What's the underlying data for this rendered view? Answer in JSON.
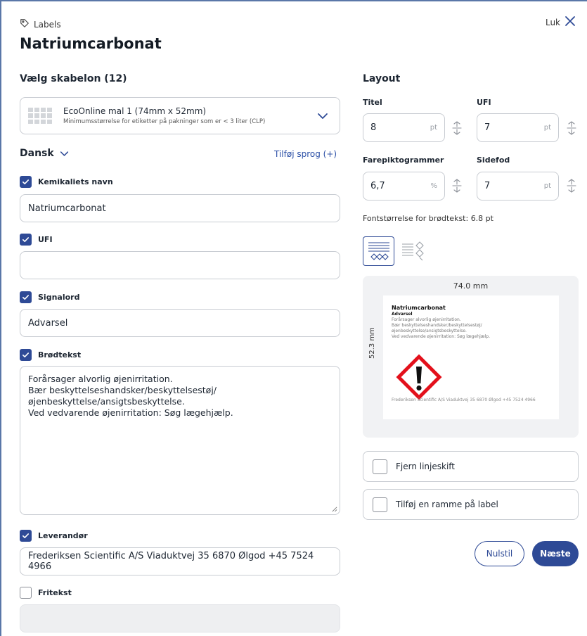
{
  "header": {
    "breadcrumb": "Labels",
    "close_label": "Luk",
    "title": "Natriumcarbonat"
  },
  "template": {
    "heading": "Vælg skabelon (12)",
    "selected_name": "EcoOnline mal 1 (74mm x 52mm)",
    "selected_desc": "Minimumsstørrelse for etiketter på pakninger som er < 3 liter (CLP)"
  },
  "language": {
    "current": "Dansk",
    "add_label": "Tilføj sprog (+)"
  },
  "fields": {
    "chemical_name": {
      "label": "Kemikaliets navn",
      "checked": true,
      "value": "Natriumcarbonat"
    },
    "ufi": {
      "label": "UFI",
      "checked": true,
      "value": ""
    },
    "signal_word": {
      "label": "Signalord",
      "checked": true,
      "value": "Advarsel"
    },
    "body_text": {
      "label": "Brødtekst",
      "checked": true,
      "lines": [
        "Forårsager alvorlig øjenirritation.",
        "Bær beskyttelseshandsker/beskyttelsestøj/",
        "øjenbeskyttelse/ansigtsbeskyttelse.",
        "Ved vedvarende øjenirritation: Søg lægehjælp."
      ]
    },
    "supplier": {
      "label": "Leverandør",
      "checked": true,
      "value": "Frederiksen Scientific A/S Viaduktvej 35 6870 Ølgod +45 7524 4966"
    },
    "free_text": {
      "label": "Fritekst",
      "checked": false,
      "value": ""
    }
  },
  "layout": {
    "heading": "Layout",
    "title": {
      "label": "Titel",
      "value": "8",
      "unit": "pt"
    },
    "ufi": {
      "label": "UFI",
      "value": "7",
      "unit": "pt"
    },
    "pictograms": {
      "label": "Farepiktogrammer",
      "value": "6,7",
      "unit": "%"
    },
    "footer": {
      "label": "Sidefod",
      "value": "7",
      "unit": "pt"
    },
    "body_font_size": "Fontstørrelse for brødtekst: 6.8 pt"
  },
  "preview": {
    "width": "74.0 mm",
    "height": "52.3 mm",
    "name": "Natriumcarbonat",
    "signal": "Advarsel",
    "body_lines": [
      "Forårsager alvorlig øjenirritation.",
      "Bær beskyttelseshandsker/beskyttelsestøj/",
      "øjenbeskyttelse/ansigtsbeskyttelse.",
      "Ved vedvarende øjenirritation: Søg lægehjælp."
    ],
    "supplier": "Frederiksen Scientific A/S Viaduktvej 35 6870 Ølgod +45 7524 4966"
  },
  "options": {
    "remove_linebreaks": "Fjern linjeskift",
    "add_frame": "Tilføj en ramme på label"
  },
  "actions": {
    "reset": "Nulstil",
    "next": "Næste"
  },
  "colors": {
    "accent": "#2e4a96",
    "link": "#2b4fa6",
    "hazard_red": "#e3101b"
  }
}
